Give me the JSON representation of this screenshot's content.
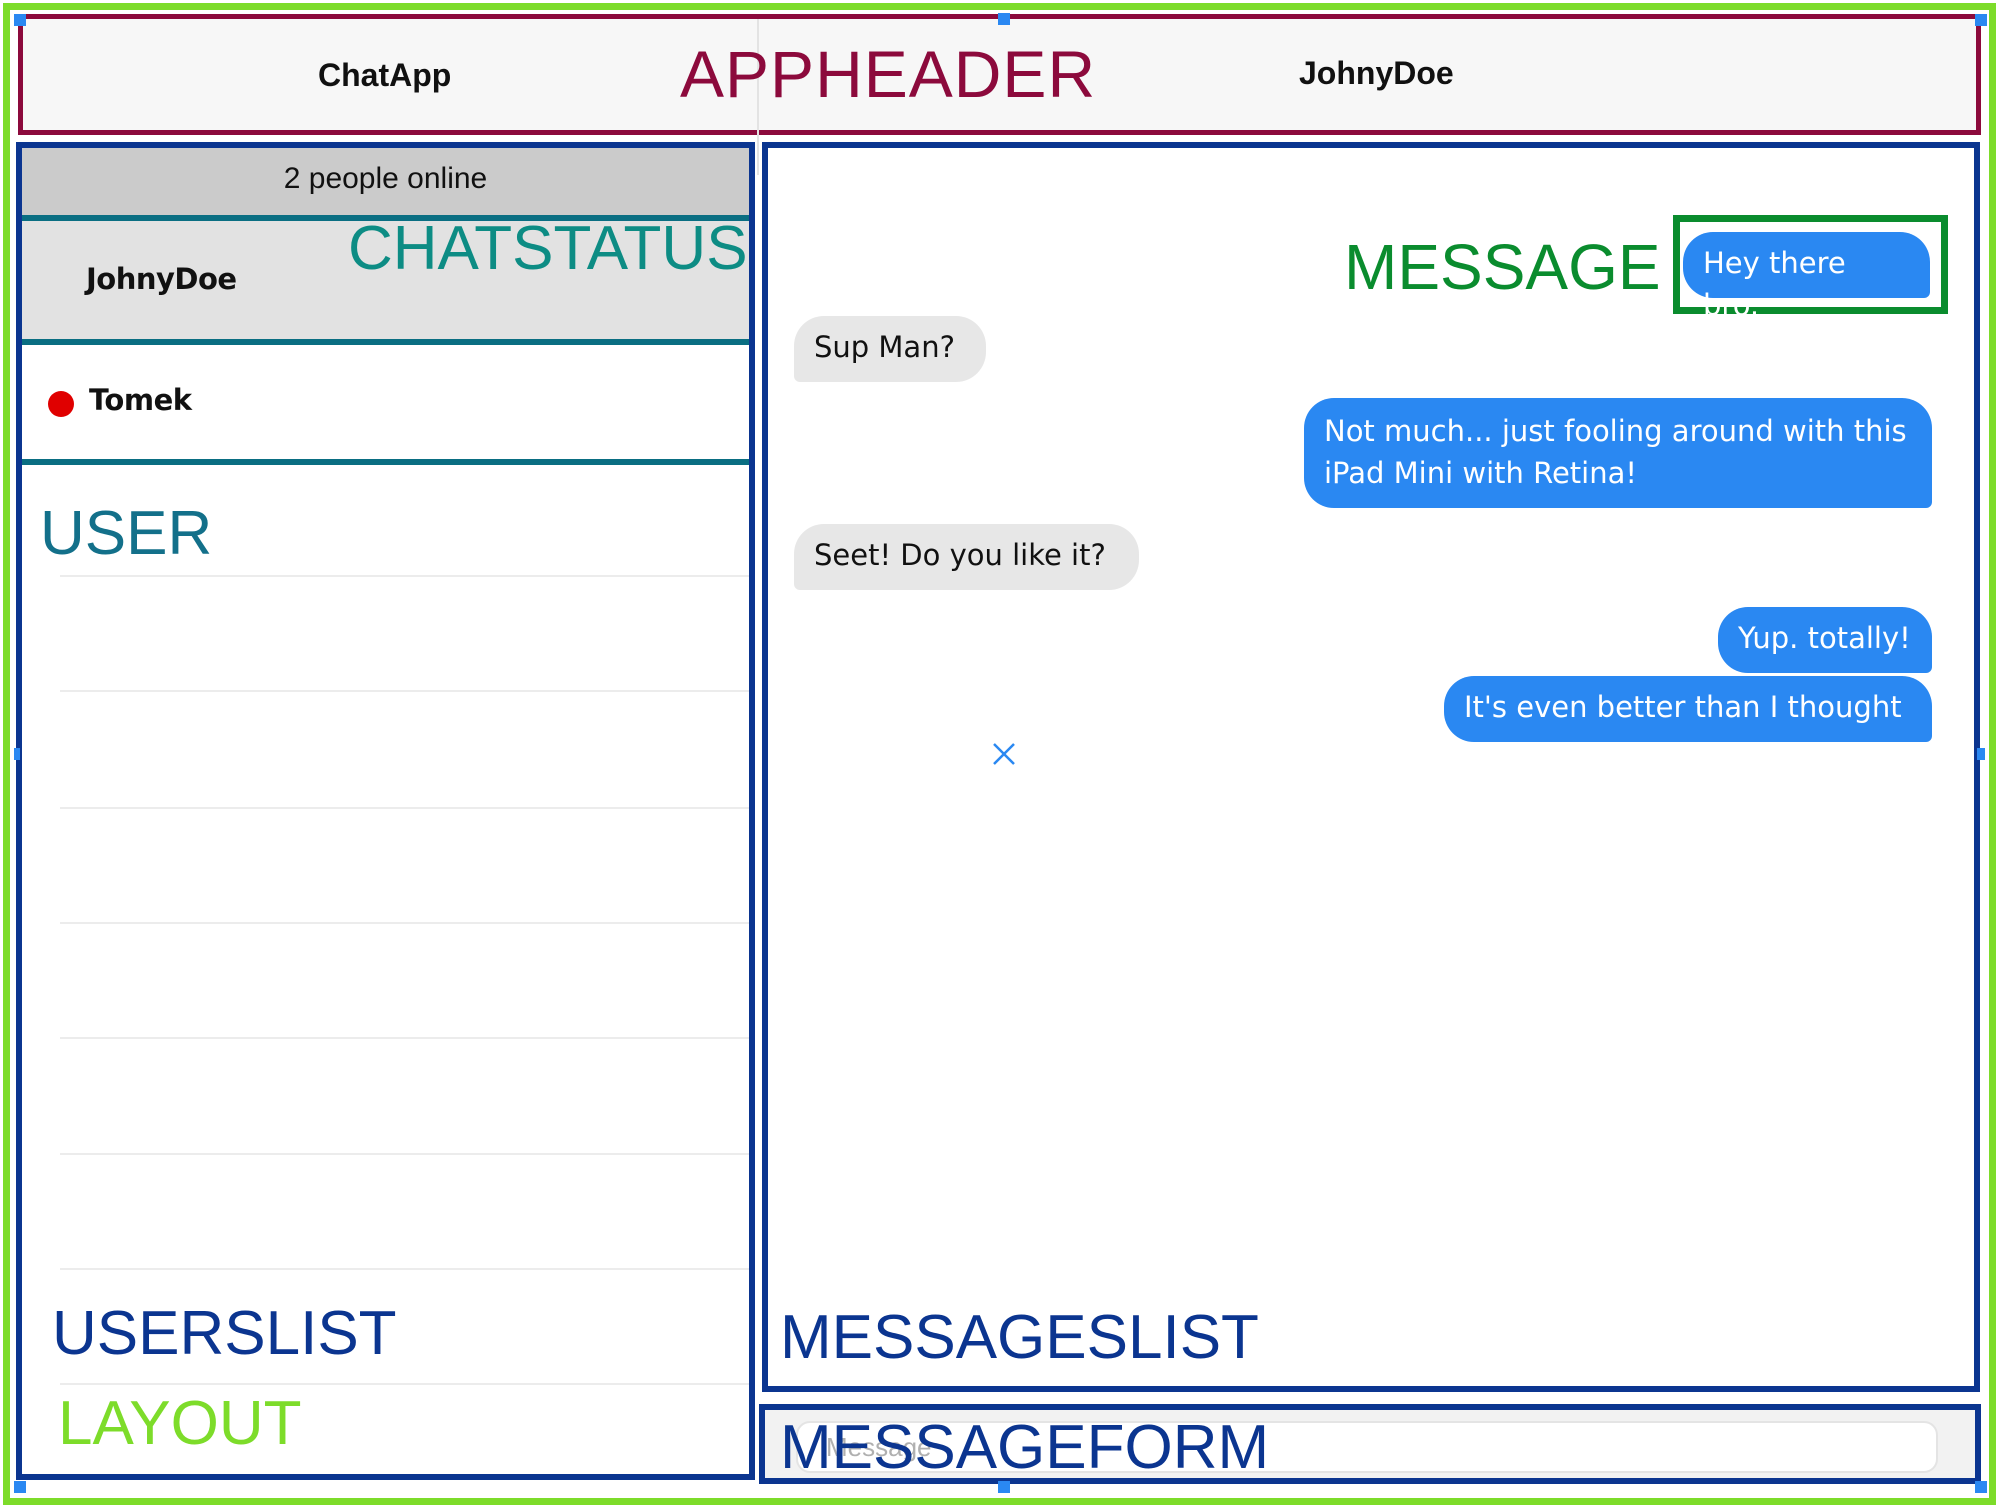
{
  "header": {
    "app_title": "ChatApp",
    "username": "JohnyDoe"
  },
  "sidebar": {
    "status": "2 people online",
    "users": [
      {
        "name": "JohnyDoe",
        "online": true
      },
      {
        "name": "Tomek",
        "online": false,
        "status_color": "#e00000"
      }
    ]
  },
  "messages": [
    {
      "text": "Hey there bro.",
      "direction": "outgoing"
    },
    {
      "text": "Sup Man?",
      "direction": "incoming"
    },
    {
      "text": "Not much... just fooling around with this iPad Mini with Retina!",
      "direction": "outgoing"
    },
    {
      "text": "Seet! Do you like it?",
      "direction": "incoming"
    },
    {
      "text": "Yup. totally!",
      "direction": "outgoing"
    },
    {
      "text": "It's even better than I thought",
      "direction": "outgoing"
    }
  ],
  "form": {
    "placeholder": "Message"
  },
  "labels": {
    "appheader": "APPHEADER",
    "chatstatus": "CHATSTATUS",
    "user": "USER",
    "userslist": "USERSLIST",
    "layout": "LAYOUT",
    "message": "MESSAGE",
    "messageslist": "MESSAGESLIST",
    "messageform": "MESSAGEFORM"
  },
  "colors": {
    "layout": "#7ddc2a",
    "appheader": "#8c0a3c",
    "chatstatus": "#0d8c84",
    "user": "#13708a",
    "list": "#0b3590",
    "message": "#0a8c2e",
    "bubble_out": "#2a88f2",
    "bubble_in": "#e7e7e7"
  },
  "icons": {
    "close": "close-icon",
    "status_dot": "status-dot-icon"
  }
}
